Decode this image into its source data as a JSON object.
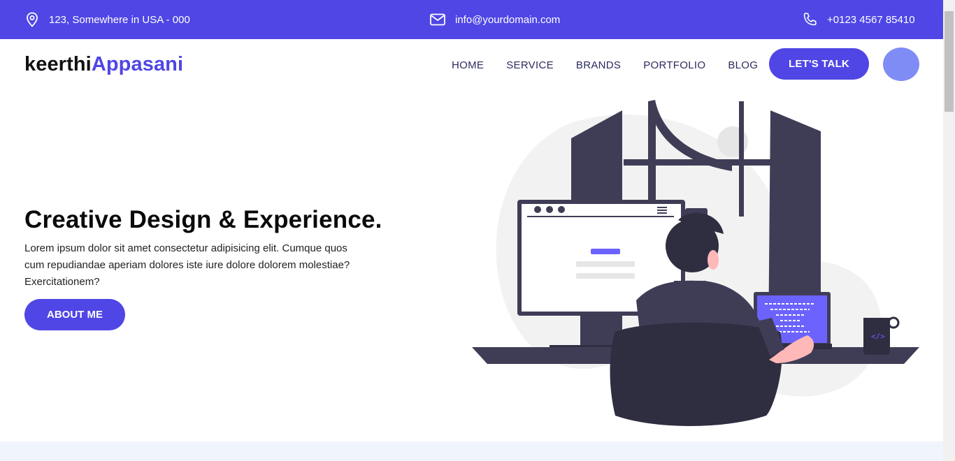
{
  "topbar": {
    "address": "123, Somewhere in USA - 000",
    "email": "info@yourdomain.com",
    "phone": "+0123 4567 85410",
    "icons": [
      "location-pin-icon",
      "envelope-icon",
      "phone-icon"
    ]
  },
  "brand": {
    "first": "keerthi",
    "second": "Appasani"
  },
  "nav": {
    "items": [
      "HOME",
      "SERVICE",
      "BRANDS",
      "PORTFOLIO",
      "BLOG"
    ],
    "cta": "LET'S TALK"
  },
  "hero": {
    "title": "Creative Design & Experience.",
    "text": "Lorem ipsum dolor sit amet consectetur adipisicing elit. Cumque quos cum repudiandae aperiam dolores iste iure dolore dolorem molestiae? Exercitationem?",
    "button": "ABOUT ME"
  },
  "colors": {
    "primary": "#4f46e5",
    "accent_light": "#7f8cf5",
    "dark": "#3f3d56",
    "band": "#f0f5fd"
  }
}
